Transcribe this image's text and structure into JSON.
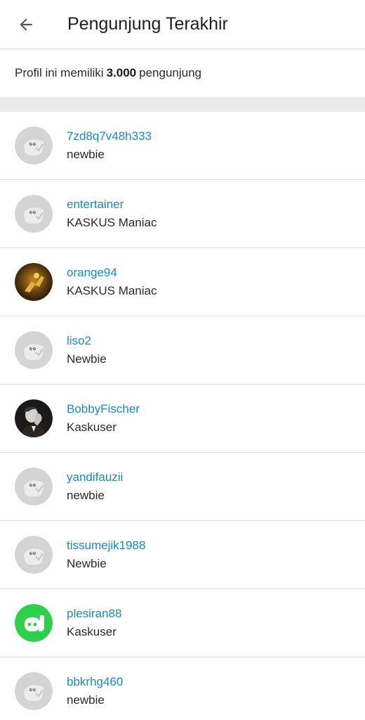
{
  "header": {
    "title": "Pengunjung Terakhir",
    "back_icon": "arrow-left-icon"
  },
  "summary": {
    "prefix": "Profil ini memiliki",
    "count": "3.000",
    "suffix": "pengunjung"
  },
  "colors": {
    "link": "#1a89c0",
    "default_avatar_bg": "#d4d4d4",
    "green_avatar_bg": "#2ecf4b"
  },
  "visitors": [
    {
      "username": "7zd8q7v48h333",
      "rank": "newbie",
      "avatar": "default-avatar-icon"
    },
    {
      "username": "entertainer",
      "rank": "KASKUS Maniac",
      "avatar": "default-avatar-icon"
    },
    {
      "username": "orange94",
      "rank": "KASKUS Maniac",
      "avatar": "photo-avatar-orange"
    },
    {
      "username": "liso2",
      "rank": "Newbie",
      "avatar": "default-avatar-icon"
    },
    {
      "username": "BobbyFischer",
      "rank": "Kaskuser",
      "avatar": "photo-avatar-portrait"
    },
    {
      "username": "yandifauzii",
      "rank": "newbie",
      "avatar": "default-avatar-icon"
    },
    {
      "username": "tissumejik1988",
      "rank": "Newbie",
      "avatar": "default-avatar-icon"
    },
    {
      "username": "plesiran88",
      "rank": "Kaskuser",
      "avatar": "green-mascot-avatar-icon"
    },
    {
      "username": "bbkrhg460",
      "rank": "newbie",
      "avatar": "default-avatar-icon"
    }
  ]
}
